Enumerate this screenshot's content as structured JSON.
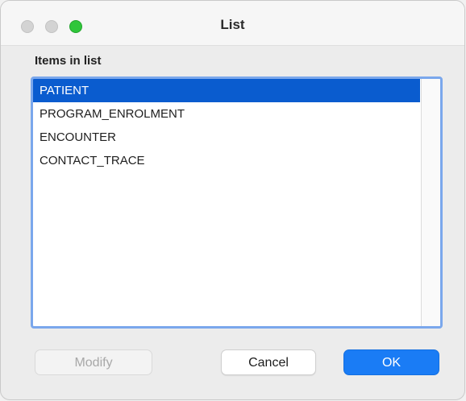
{
  "window": {
    "title": "List"
  },
  "list": {
    "label": "Items in list",
    "items": [
      {
        "label": "PATIENT",
        "selected": true
      },
      {
        "label": "PROGRAM_ENROLMENT",
        "selected": false
      },
      {
        "label": "ENCOUNTER",
        "selected": false
      },
      {
        "label": "CONTACT_TRACE",
        "selected": false
      }
    ]
  },
  "buttons": {
    "modify_label": "Modify",
    "cancel_label": "Cancel",
    "ok_label": "OK"
  },
  "colors": {
    "selection": "#0a5ccf",
    "focus_ring": "#7aa7ec",
    "primary_button": "#1a7cf5",
    "zoom_button": "#2fc63a"
  }
}
